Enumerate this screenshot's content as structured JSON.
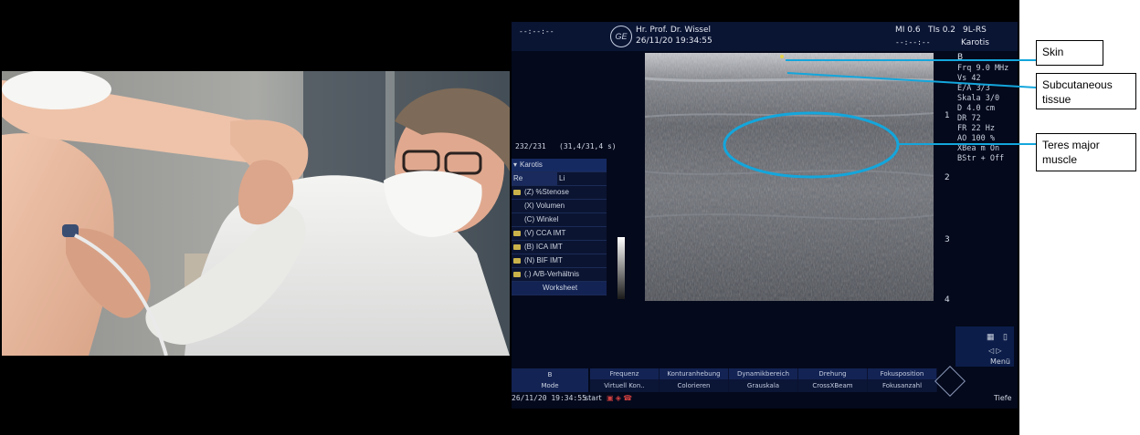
{
  "ultrasound": {
    "header_left": "--:--:--",
    "header_doctor": "Hr. Prof. Dr. Wissel",
    "header_datetime": "26/11/20 19:34:55",
    "mi": "MI 0.6",
    "tis": "TIs 0.2",
    "probe": "9L-RS",
    "header_left2": "--:--:--",
    "preset": "Karotis",
    "mode_letter": "B",
    "params": [
      "Frq    9.0 MHz",
      "Vs     42",
      "E/A    3/3",
      "Skala  3/0",
      "D      4.0 cm",
      "DR     72",
      "FR     22 Hz",
      "AO     100 %",
      "XBea m On",
      "BStr  + Off"
    ],
    "depth_marks": [
      "1",
      "2",
      "3",
      "4"
    ],
    "frame_counter": "232/231",
    "frame_time": "(31,4/31,4 s)",
    "measure_title": "Karotis",
    "side_re": "Re",
    "side_li": "Li",
    "measure_items": [
      "(Z) %Stenose",
      "(X) Volumen",
      "(C) Winkel",
      "(V) CCA IMT",
      "(B) ICA IMT",
      "(N) BIF IMT",
      "(.) A/B-Verhältnis"
    ],
    "worksheet": "Worksheet",
    "b_mode_top": "B",
    "b_mode_bottom": "Mode",
    "bottom_tabs": [
      "Frequenz",
      "Konturanhebung",
      "Dynamikbereich",
      "Drehung",
      "Fokusposition"
    ],
    "bottom_subs": [
      "Virtuell Kon..",
      "Colorieren",
      "Grauskala",
      "CrossXBeam",
      "Fokusanzahl"
    ],
    "footer_datetime": "26/11/20 19:34:55",
    "footer_start": "start",
    "menu": "Menü",
    "tiefe": "Tiefe",
    "logo": "GE"
  },
  "annotations": {
    "skin": "Skin",
    "subcutaneous": "Subcutaneous tissue",
    "teres": "Teres major muscle",
    "line_color": "#13a6dc"
  }
}
